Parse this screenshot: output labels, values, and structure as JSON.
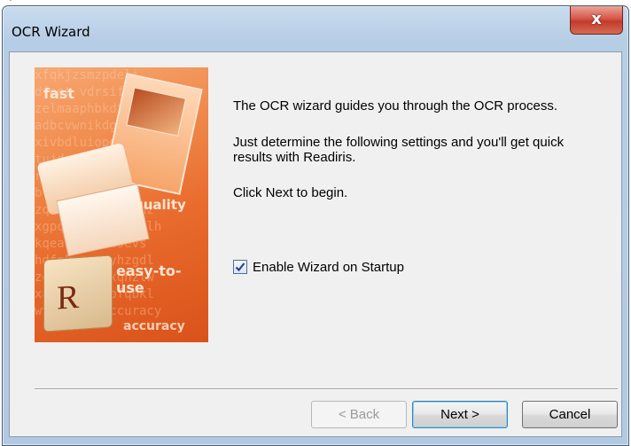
{
  "window": {
    "title": "OCR Wizard",
    "close_glyph": "x"
  },
  "banner": {
    "words": [
      "fast",
      "quality",
      "easy-to-use",
      "accuracy"
    ],
    "logo_letter": "R"
  },
  "content": {
    "line1": "The OCR wizard guides you through the OCR process.",
    "line2": "Just determine the following settings and you'll get quick results with Readiris.",
    "line3": "Click Next to begin."
  },
  "options": {
    "enable_wizard_label": "Enable Wizard on Startup",
    "enable_wizard_checked": true
  },
  "buttons": {
    "back": "< Back",
    "next": "Next >",
    "cancel": "Cancel"
  }
}
